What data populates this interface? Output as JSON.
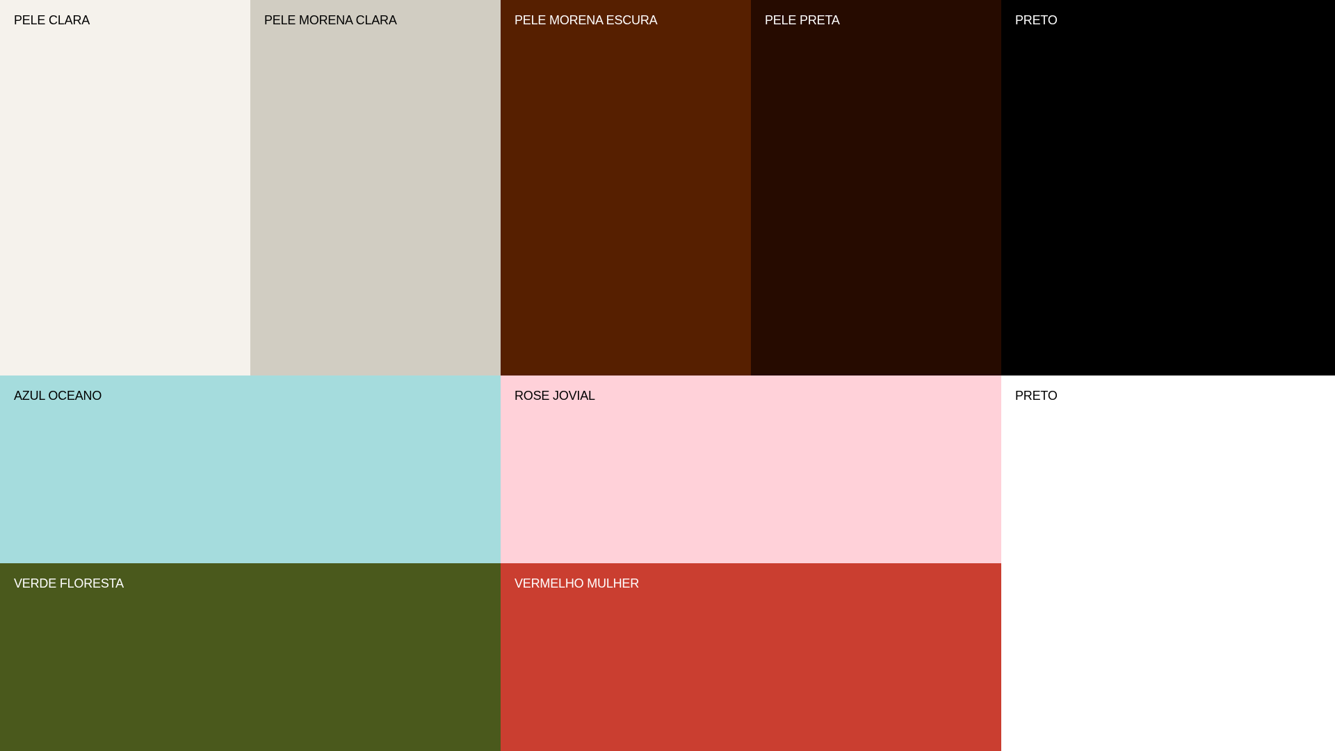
{
  "swatches": [
    {
      "label": "PELE CLARA",
      "color": "#f5f2ec",
      "text_color": "#000000"
    },
    {
      "label": "PELE MORENA CLARA",
      "color": "#d1cdc2",
      "text_color": "#000000"
    },
    {
      "label": "PELE MORENA ESCURA",
      "color": "#561f00",
      "text_color": "#ffffff"
    },
    {
      "label": "PELE PRETA",
      "color": "#260b00",
      "text_color": "#ffffff"
    },
    {
      "label": "PRETO",
      "color": "#000000",
      "text_color": "#ffffff"
    },
    {
      "label": "AZUL OCEANO",
      "color": "#a5dcdd",
      "text_color": "#000000"
    },
    {
      "label": "ROSE JOVIAL",
      "color": "#ffd1d9",
      "text_color": "#000000"
    },
    {
      "label": "PRETO",
      "color": "#ffffff",
      "text_color": "#000000"
    },
    {
      "label": "VERDE FLORESTA",
      "color": "#4a591c",
      "text_color": "#ffffff"
    },
    {
      "label": "VERMELHO MULHER",
      "color": "#ca3e30",
      "text_color": "#ffffff"
    }
  ]
}
